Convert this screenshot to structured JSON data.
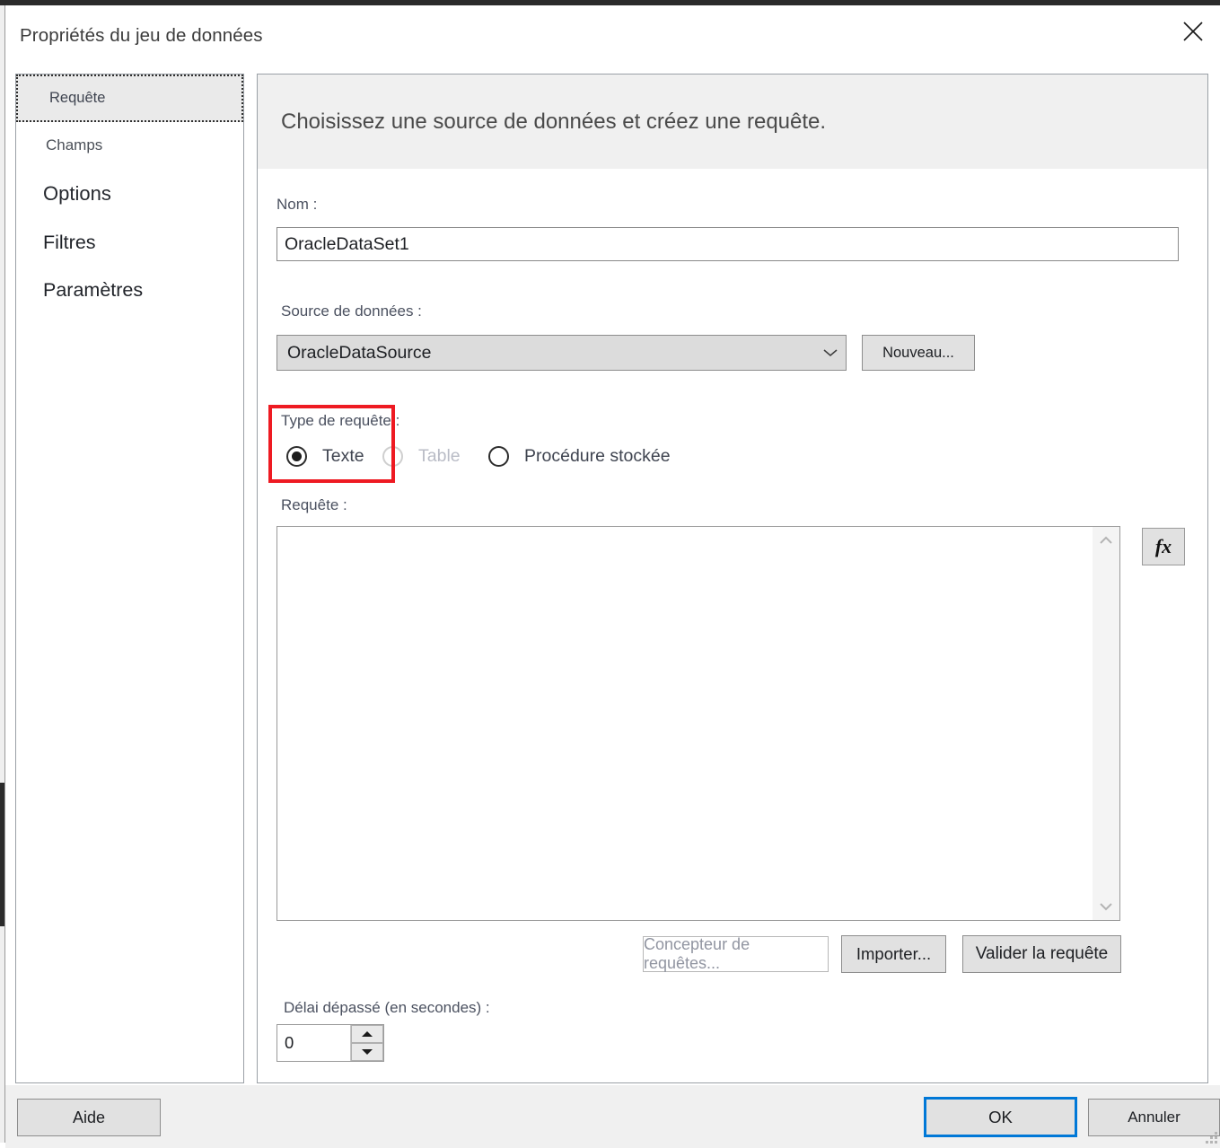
{
  "window": {
    "title": "Propriétés du jeu de données",
    "close_icon": "close-icon"
  },
  "sidebar": {
    "items": [
      {
        "label": "Requête",
        "selected": true
      },
      {
        "label": "Champs",
        "selected": false
      },
      {
        "label": "Options",
        "selected": false
      },
      {
        "label": "Filtres",
        "selected": false
      },
      {
        "label": "Paramètres",
        "selected": false
      }
    ]
  },
  "content": {
    "header": "Choisissez une source de données et créez une requête.",
    "name": {
      "label": "Nom :",
      "value": "OracleDataSet1"
    },
    "data_source": {
      "label": "Source de données :",
      "selected": "OracleDataSource",
      "options": [
        "OracleDataSource"
      ],
      "dropdown_icon": "chevron-down-icon",
      "new_button": "Nouveau..."
    },
    "query_type": {
      "label": "Type de requête :",
      "options": [
        {
          "label": "Texte",
          "checked": true,
          "disabled": false
        },
        {
          "label": "Table",
          "checked": false,
          "disabled": true
        },
        {
          "label": "Procédure stockée",
          "checked": false,
          "disabled": false
        }
      ],
      "highlight_color": "#ee1a22"
    },
    "query": {
      "label": "Requête :",
      "value": "",
      "placeholder": "",
      "expression_button": "fx",
      "scroll_up_icon": "chevron-up-icon",
      "scroll_down_icon": "chevron-down-icon"
    },
    "query_actions": {
      "designer": "Concepteur de requêtes...",
      "import": "Importer...",
      "validate": "Valider la requête"
    },
    "timeout": {
      "label": "Délai dépassé (en secondes) :",
      "value": "0",
      "up_icon": "spinner-up-icon",
      "down_icon": "spinner-down-icon"
    }
  },
  "footer": {
    "help": "Aide",
    "ok": "OK",
    "cancel": "Annuler",
    "focus_color": "#0078d7",
    "resize_grip_icon": "resize-grip-icon"
  }
}
